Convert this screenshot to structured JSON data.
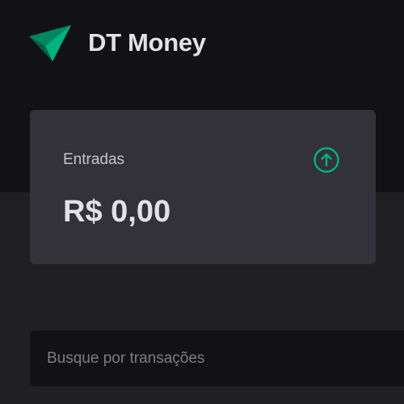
{
  "header": {
    "app_title": "DT Money",
    "logo_icon": "dt-money-logo",
    "logo_colors": [
      "#00b37e",
      "#00875f",
      "#015f43"
    ]
  },
  "summary": {
    "income": {
      "label": "Entradas",
      "value": "R$ 0,00",
      "icon": "arrow-circle-up-icon",
      "icon_color": "#00b37e"
    }
  },
  "search": {
    "placeholder": "Busque por transações",
    "value": ""
  },
  "colors": {
    "background": "#202024",
    "header_background": "#121214",
    "card_background": "#323238",
    "accent": "#00b37e"
  }
}
